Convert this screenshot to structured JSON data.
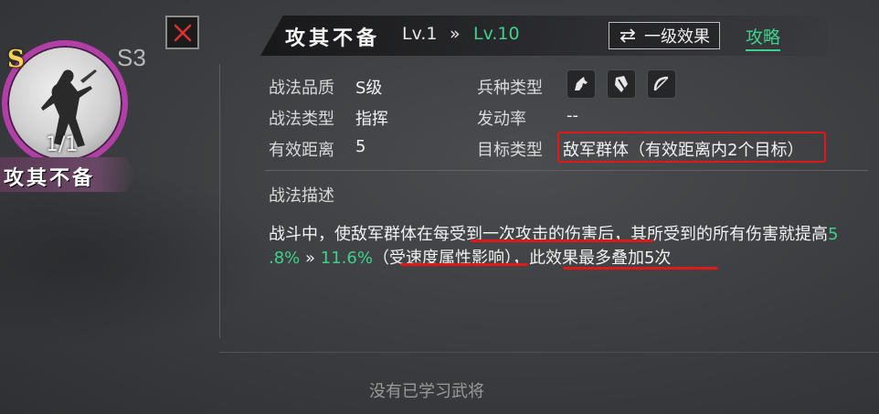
{
  "card": {
    "grade": "S",
    "grade_level": "S3",
    "count": "1/1",
    "skill_name": "攻其不备",
    "frame_color": "#b23fa8"
  },
  "header": {
    "title": "攻其不备",
    "level_current": "Lv.1",
    "level_arrow": "»",
    "level_max": "Lv.10",
    "effect_button": "一级效果",
    "effect_icon": "swap-arrows-icon",
    "strategy_link": "攻略",
    "accent_green": "#3fd18b"
  },
  "attributes": {
    "quality_label": "战法品质",
    "quality_value": "S级",
    "type_label": "战法类型",
    "type_value": "指挥",
    "range_label": "有效距离",
    "range_value": "5",
    "unit_label": "兵种类型",
    "unit_icons": [
      "cavalry-icon",
      "shield-icon",
      "bow-icon"
    ],
    "trigger_label": "发动率",
    "trigger_value": "--",
    "target_label": "目标类型",
    "target_value": "敌军群体（有效距离内2个目标）",
    "highlight_color": "#e01818"
  },
  "description": {
    "title": "战法描述",
    "line1_text": "战斗中，使敌军群体在每受到一次攻击的伤害后，其所受到的所有伤害就提高",
    "line1_tail": "5",
    "line2_val_start": ".8%",
    "line2_arrow": "»",
    "line2_val_end": "11.6%",
    "line2_note": "（受速度属性影响），此效果最多叠加5次"
  },
  "footer": {
    "empty_note": "没有已学习武将"
  }
}
